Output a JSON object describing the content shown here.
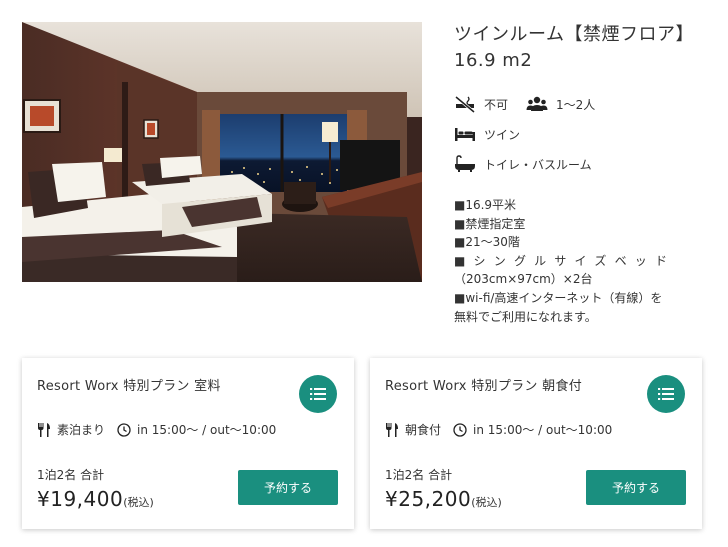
{
  "room": {
    "title_line1": "ツインルーム【禁煙フロア】",
    "title_line2": "16.9 m2",
    "features": {
      "smoking": "不可",
      "capacity": "1～2人",
      "bed": "ツイン",
      "bath": "トイレ・バスルーム"
    },
    "details": [
      "■16.9平米",
      "■禁煙指定室",
      "■21～30階",
      "■シングルサイズベッド",
      "（203cm×97cm）×2台",
      "■wi-fi/高速インターネット（有線）を",
      "無料でご利用になれます。"
    ]
  },
  "plans": [
    {
      "name": "Resort Worx 特別プラン 室料",
      "meal": "素泊まり",
      "checkin": "in 15:00～ / out～10:00",
      "guests": "1泊2名 合計",
      "price": "¥19,400",
      "tax": "(税込)",
      "button": "予約する"
    },
    {
      "name": "Resort Worx 特別プラン 朝食付",
      "meal": "朝食付",
      "checkin": "in 15:00～ / out～10:00",
      "guests": "1泊2名 合計",
      "price": "¥25,200",
      "tax": "(税込)",
      "button": "予約する"
    }
  ],
  "colors": {
    "accent": "#1a8f7f",
    "text": "#333333"
  },
  "icons": [
    "no-smoking-icon",
    "people-icon",
    "bed-icon",
    "bathtub-icon",
    "fork-knife-icon",
    "clock-icon",
    "list-menu-icon"
  ]
}
